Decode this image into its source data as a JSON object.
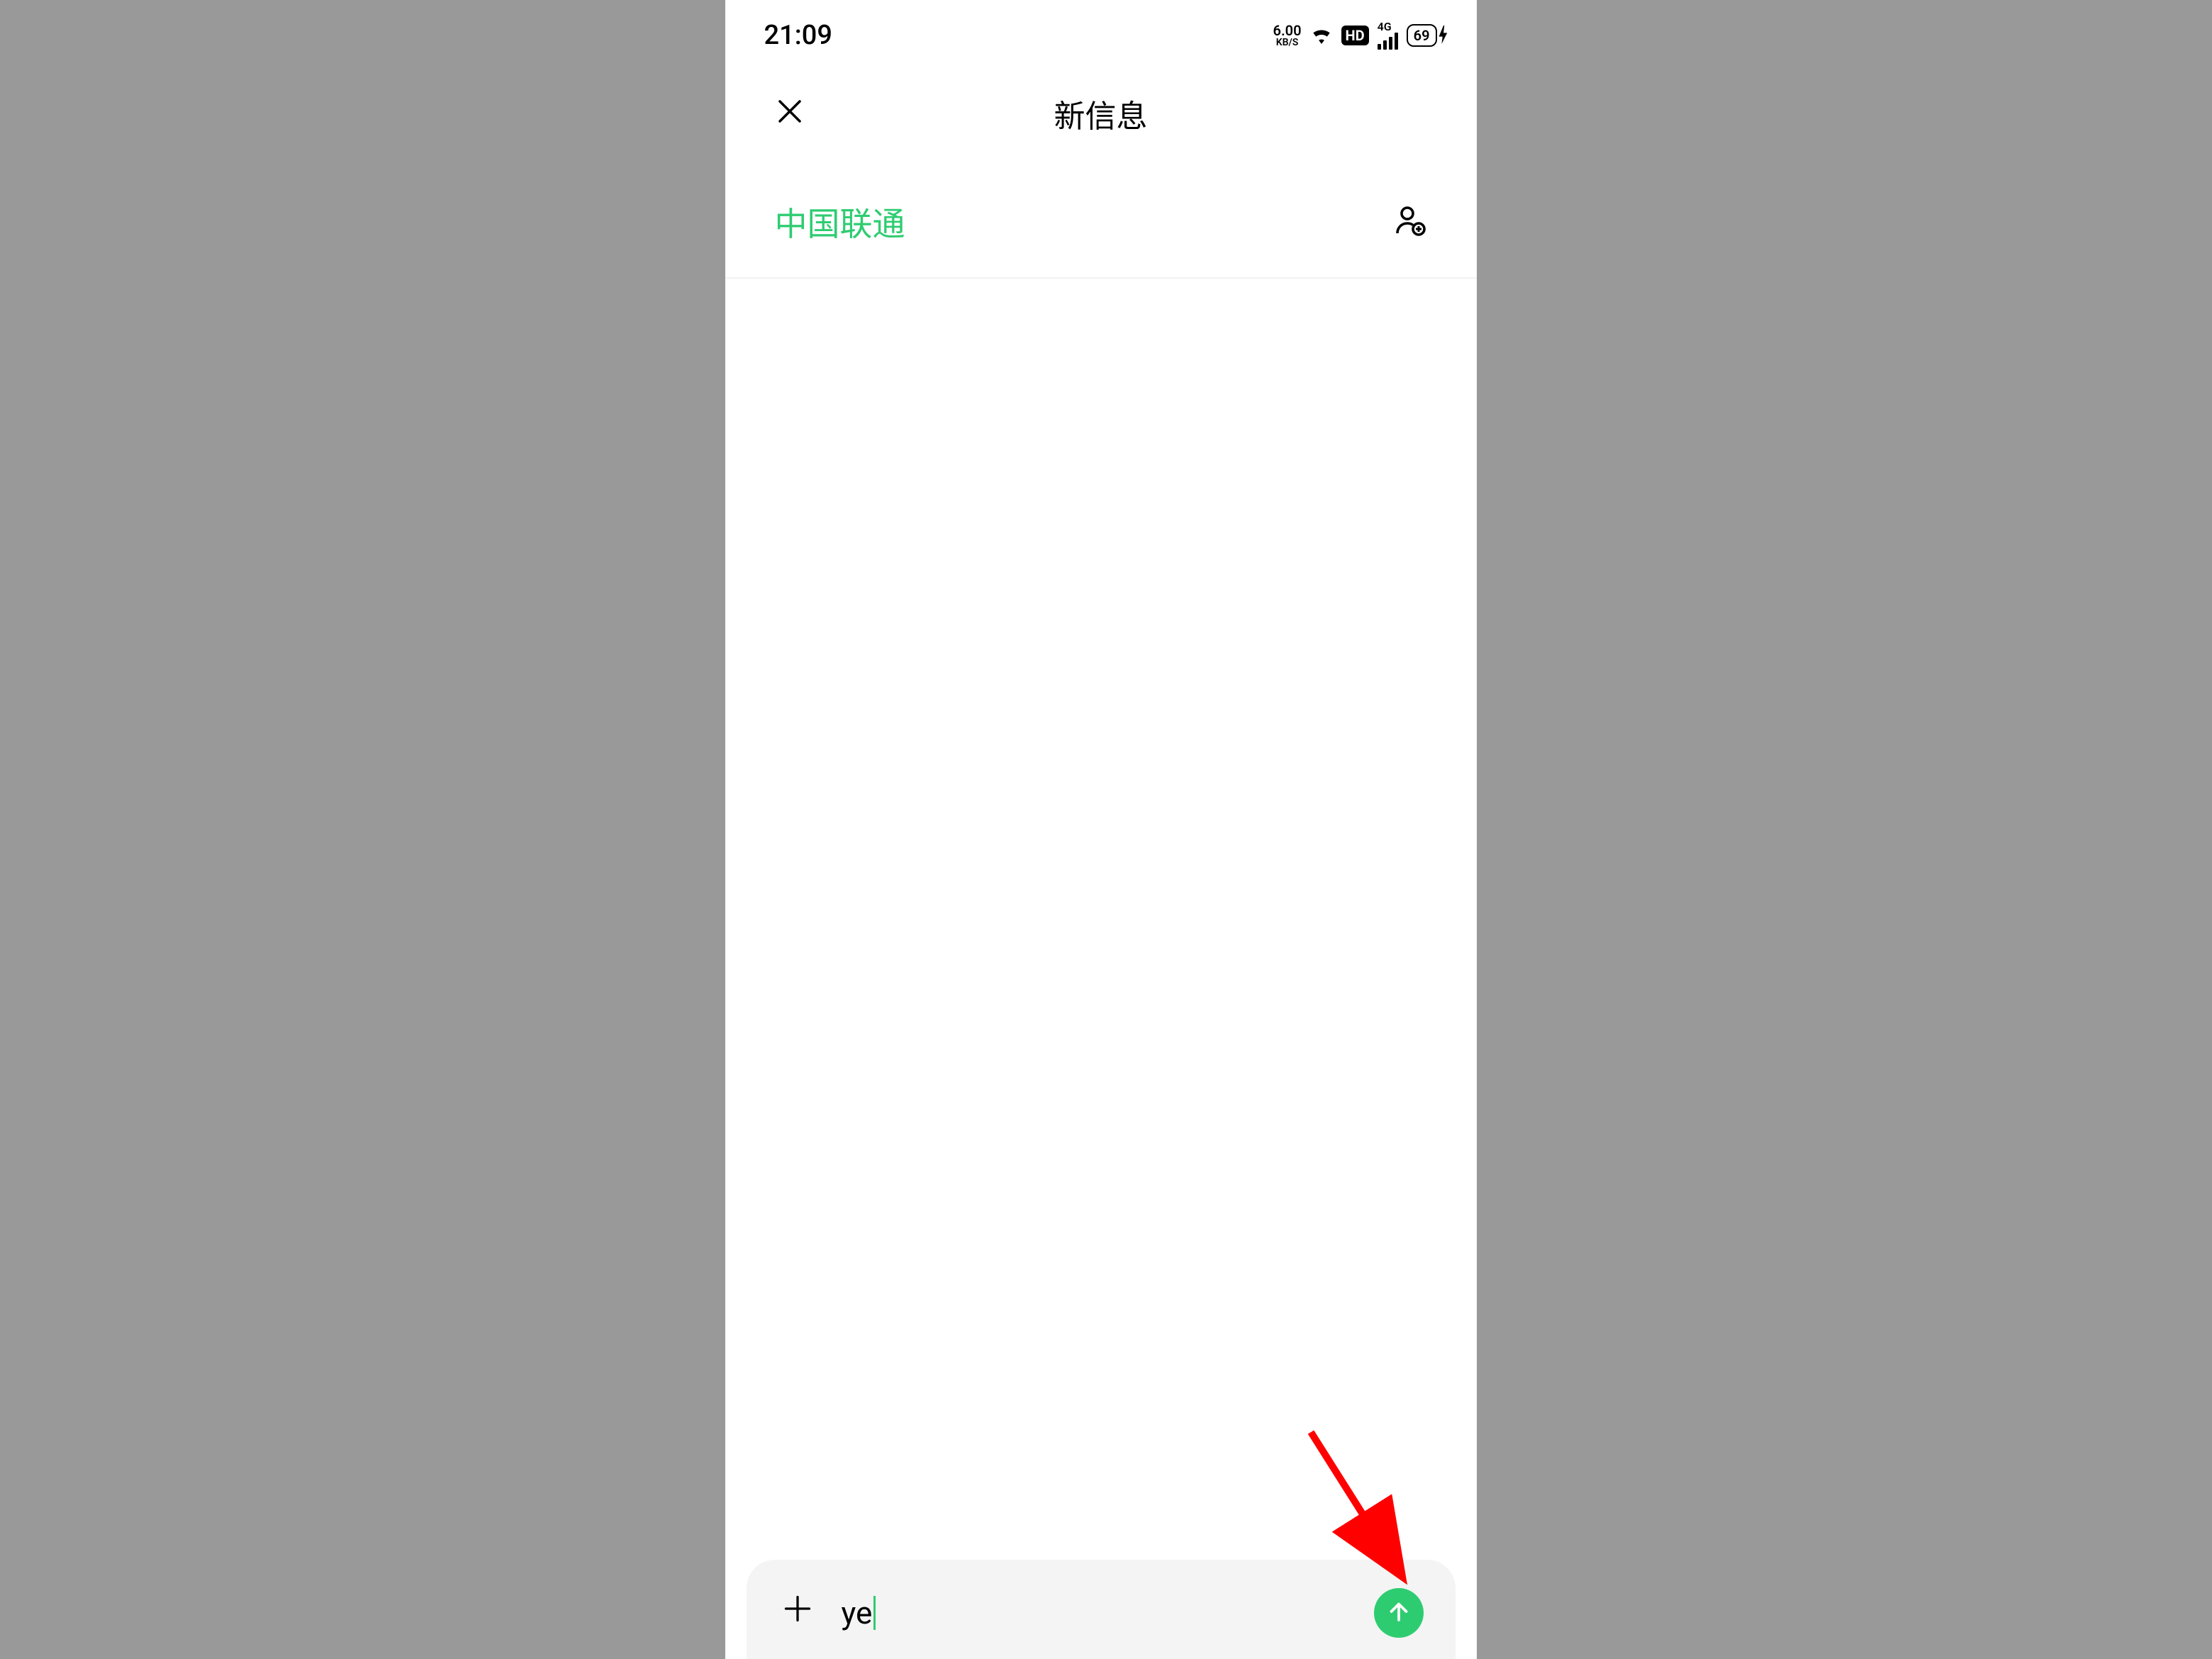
{
  "status_bar": {
    "time": "21:09",
    "speed_value": "6.00",
    "speed_unit": "KB/S",
    "hd_label": "HD",
    "network_label": "4G",
    "battery_level": "69"
  },
  "nav": {
    "title": "新信息",
    "close_icon_name": "close-icon"
  },
  "recipient": {
    "name": "中国联通",
    "add_contact_icon_name": "add-contact-icon"
  },
  "composer": {
    "plus_icon_name": "add-attachment-icon",
    "input_value": "ye",
    "send_icon_name": "send-arrow-up-icon"
  },
  "colors": {
    "accent": "#2ecc71",
    "background": "#ffffff",
    "outer_background": "#999999",
    "input_bg": "#f4f4f4",
    "annotation_arrow": "#ff0000"
  }
}
